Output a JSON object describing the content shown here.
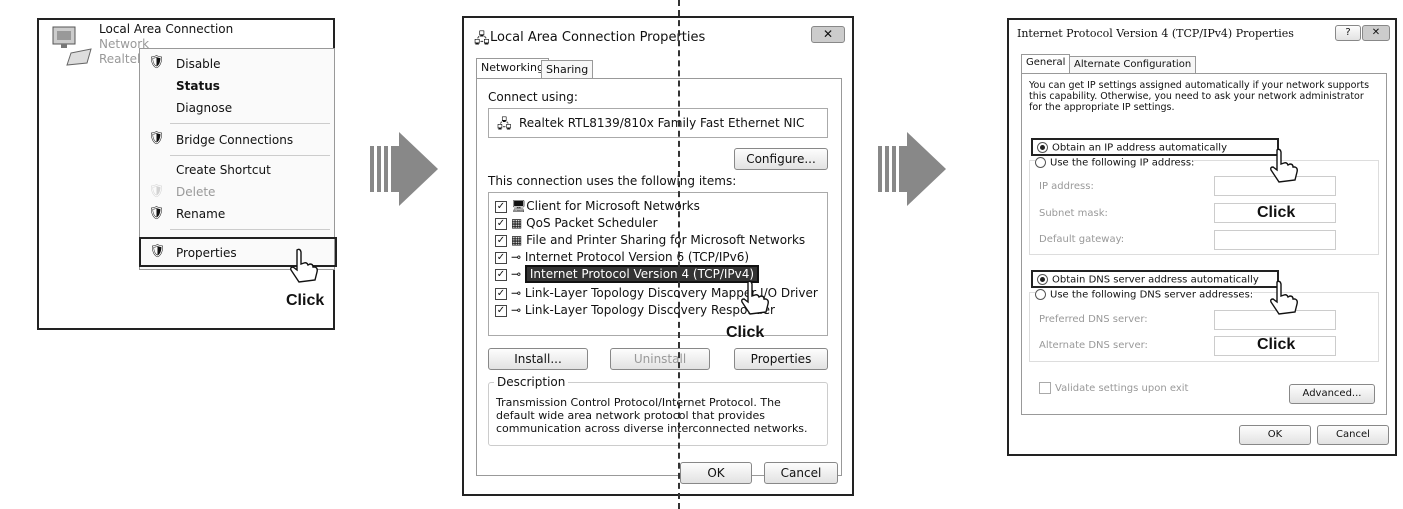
{
  "menu_panel": {
    "connection": {
      "name": "Local Area Connection",
      "sub1": "Network",
      "sub2": "Realtek"
    },
    "items": [
      "Disable",
      "Status",
      "Diagnose",
      "Bridge Connections",
      "Create Shortcut",
      "Delete",
      "Rename",
      "Properties"
    ],
    "click_label": "Click"
  },
  "lan_props": {
    "title": "Local Area Connection Properties",
    "tabs": [
      "Networking",
      "Sharing"
    ],
    "connect_using_label": "Connect using:",
    "adapter": "Realtek RTL8139/810x Family Fast Ethernet NIC",
    "configure": "Configure...",
    "items_label": "This connection uses the following items:",
    "items": [
      "Client for Microsoft Networks",
      "QoS Packet Scheduler",
      "File and Printer Sharing for Microsoft Networks",
      "Internet Protocol Version 6 (TCP/IPv6)",
      "Internet Protocol Version 4 (TCP/IPv4)",
      "Link-Layer Topology Discovery Mapper I/O Driver",
      "Link-Layer Topology Discovery Responder"
    ],
    "install": "Install...",
    "uninstall": "Uninstall",
    "properties": "Properties",
    "description_label": "Description",
    "description": "Transmission Control Protocol/Internet Protocol. The default wide area network protocol that provides communication across diverse interconnected networks.",
    "ok": "OK",
    "cancel": "Cancel",
    "click_label": "Click"
  },
  "ipv4_props": {
    "title": "Internet Protocol Version 4 (TCP/IPv4) Properties",
    "tabs": [
      "General",
      "Alternate Configuration"
    ],
    "intro": "You can get IP settings assigned automatically if your network supports this capability. Otherwise, you need to ask your network administrator for the appropriate IP settings.",
    "obtain_ip": "Obtain an IP address automatically",
    "use_ip": "Use the following IP address:",
    "ip_address": "IP address:",
    "subnet": "Subnet mask:",
    "gateway": "Default gateway:",
    "obtain_dns": "Obtain DNS server address automatically",
    "use_dns": "Use the following DNS server addresses:",
    "preferred_dns": "Preferred DNS server:",
    "alternate_dns": "Alternate DNS server:",
    "validate": "Validate settings upon exit",
    "advanced": "Advanced...",
    "ok": "OK",
    "cancel": "Cancel",
    "click_label": "Click"
  },
  "colors": {
    "arrow": "#888888",
    "highlight": "#333333"
  }
}
